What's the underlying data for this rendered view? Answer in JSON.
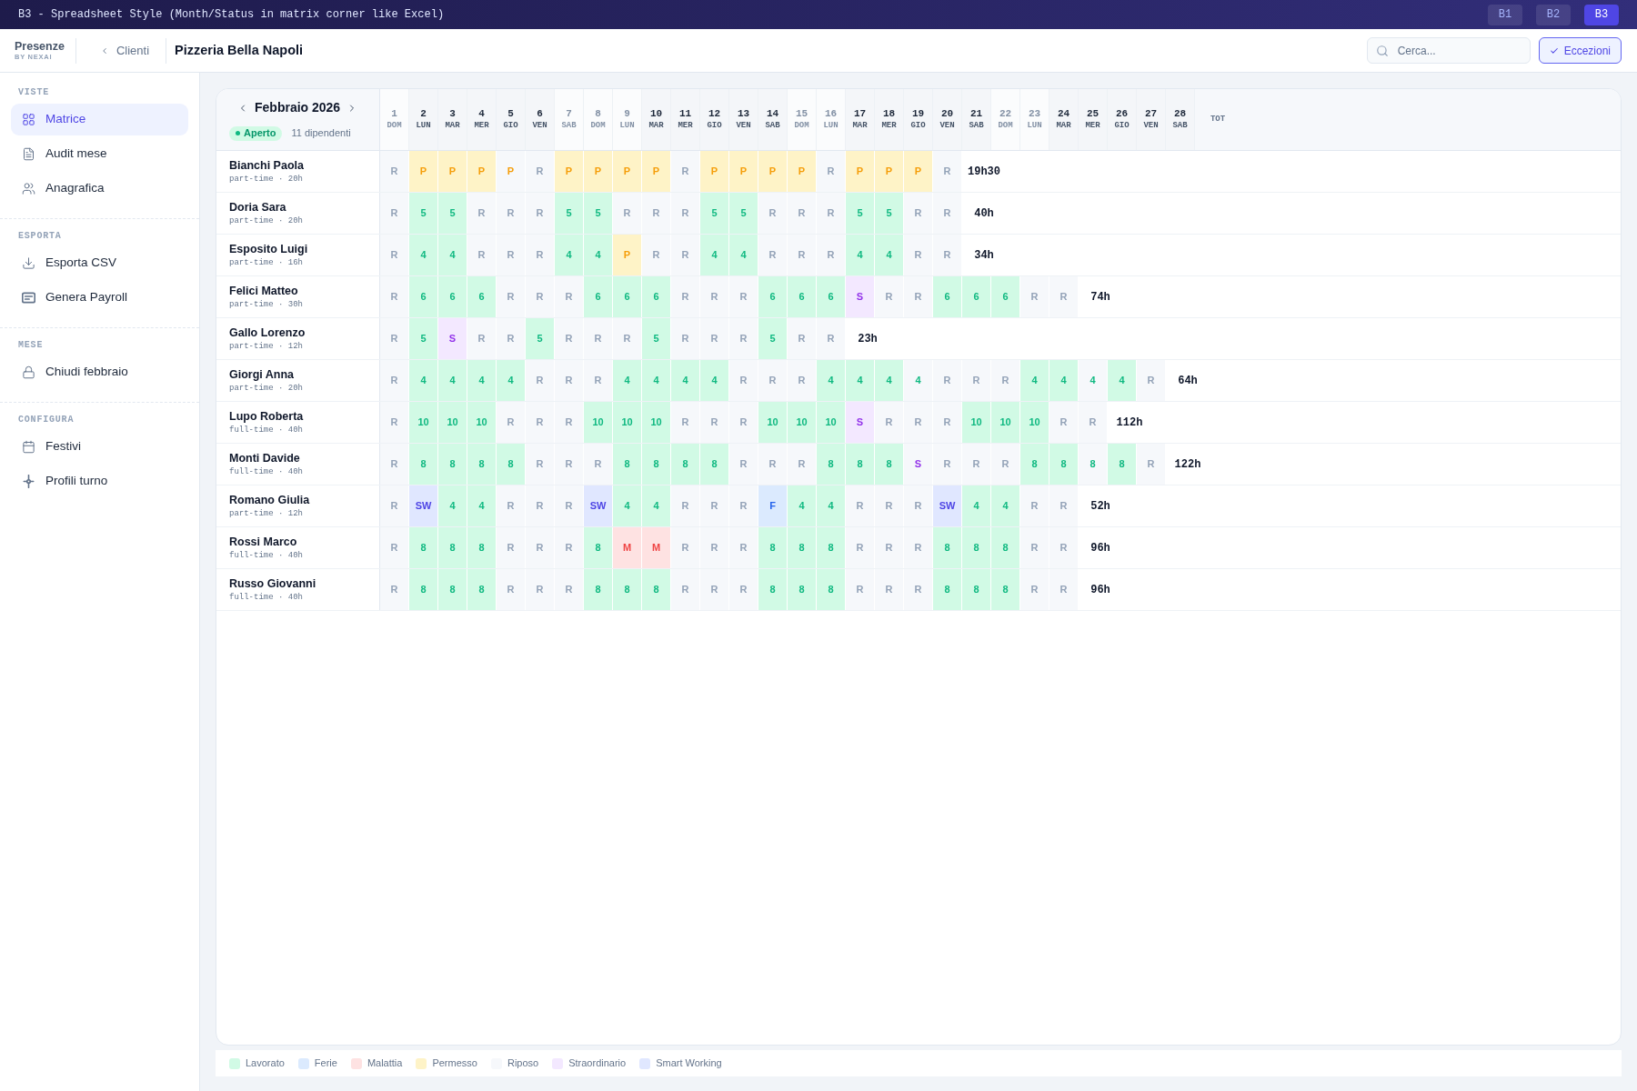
{
  "window": {
    "title": "B3 - Spreadsheet Style (Month/Status in matrix corner like Excel)",
    "variants": [
      {
        "label": "B1",
        "selected": false
      },
      {
        "label": "B2",
        "selected": false
      },
      {
        "label": "B3",
        "selected": true
      }
    ]
  },
  "header": {
    "brand": "Presenze",
    "brand_tagline": "BY NEXAI",
    "back_link": "Clienti",
    "client": "Pizzeria Bella Napoli",
    "search": {
      "placeholder": "Cerca..."
    },
    "exceptions_button": "Eccezioni"
  },
  "sidebar": {
    "sections": [
      {
        "label": "VISTE",
        "items": [
          {
            "label": "Matrice",
            "selected": true
          },
          {
            "label": "Audit mese",
            "selected": false
          },
          {
            "label": "Anagrafica",
            "selected": false
          }
        ]
      },
      {
        "label": "ESPORTA",
        "items": [
          {
            "label": "Esporta CSV",
            "selected": false
          },
          {
            "label": "Genera Payroll",
            "selected": false
          }
        ]
      },
      {
        "label": "MESE",
        "items": [
          {
            "label": "Chiudi febbraio",
            "selected": false
          }
        ]
      },
      {
        "label": "CONFIGURA",
        "items": [
          {
            "label": "Festivi",
            "selected": false
          },
          {
            "label": "Profili turno",
            "selected": false
          }
        ]
      }
    ]
  },
  "matrix": {
    "month": "Febbraio 2026",
    "status": "Aperto",
    "employee_count": "11 dipendenti",
    "days": [
      {
        "number": "1",
        "weekday": "DOM",
        "muted": true
      },
      {
        "number": "2",
        "weekday": "LUN",
        "muted": false
      },
      {
        "number": "3",
        "weekday": "MAR",
        "muted": false
      },
      {
        "number": "4",
        "weekday": "MER",
        "muted": false
      },
      {
        "number": "5",
        "weekday": "GIO",
        "muted": false
      },
      {
        "number": "6",
        "weekday": "VEN",
        "muted": false
      },
      {
        "number": "7",
        "weekday": "SAB",
        "muted": true
      },
      {
        "number": "8",
        "weekday": "DOM",
        "muted": true
      },
      {
        "number": "9",
        "weekday": "LUN",
        "muted": true
      },
      {
        "number": "10",
        "weekday": "MAR",
        "muted": false
      },
      {
        "number": "11",
        "weekday": "MER",
        "muted": false
      },
      {
        "number": "12",
        "weekday": "GIO",
        "muted": false
      },
      {
        "number": "13",
        "weekday": "VEN",
        "muted": false
      },
      {
        "number": "14",
        "weekday": "SAB",
        "muted": false
      },
      {
        "number": "15",
        "weekday": "DOM",
        "muted": true
      },
      {
        "number": "16",
        "weekday": "LUN",
        "muted": true
      },
      {
        "number": "17",
        "weekday": "MAR",
        "muted": false
      },
      {
        "number": "18",
        "weekday": "MER",
        "muted": false
      },
      {
        "number": "19",
        "weekday": "GIO",
        "muted": false
      },
      {
        "number": "20",
        "weekday": "VEN",
        "muted": false
      },
      {
        "number": "21",
        "weekday": "SAB",
        "muted": false
      },
      {
        "number": "22",
        "weekday": "DOM",
        "muted": true
      },
      {
        "number": "23",
        "weekday": "LUN",
        "muted": true
      },
      {
        "number": "24",
        "weekday": "MAR",
        "muted": false
      },
      {
        "number": "25",
        "weekday": "MER",
        "muted": false
      },
      {
        "number": "26",
        "weekday": "GIO",
        "muted": false
      },
      {
        "number": "27",
        "weekday": "VEN",
        "muted": false
      },
      {
        "number": "28",
        "weekday": "SAB",
        "muted": false
      }
    ],
    "total_header": "TOT",
    "rows": [
      {
        "name": "Bianchi Paola",
        "contract": "part-time · 20h",
        "total": "19h30",
        "cells": [
          {
            "text": "R",
            "kind": "riposo"
          },
          {
            "text": "P",
            "kind": "permesso",
            "filled": true
          },
          {
            "text": "P",
            "kind": "permesso",
            "filled": true
          },
          {
            "text": "P",
            "kind": "permesso",
            "filled": true
          },
          {
            "text": "P",
            "kind": "permesso",
            "filled": false
          },
          {
            "text": "R",
            "kind": "riposo"
          },
          {
            "text": "P",
            "kind": "permesso",
            "filled": true
          },
          {
            "text": "P",
            "kind": "permesso",
            "filled": true
          },
          {
            "text": "P",
            "kind": "permesso",
            "filled": true
          },
          {
            "text": "P",
            "kind": "permesso",
            "filled": true
          },
          {
            "text": "R",
            "kind": "riposo"
          },
          {
            "text": "P",
            "kind": "permesso",
            "filled": true
          },
          {
            "text": "P",
            "kind": "permesso",
            "filled": true
          },
          {
            "text": "P",
            "kind": "permesso",
            "filled": true
          },
          {
            "text": "P",
            "kind": "permesso",
            "filled": true
          },
          {
            "text": "R",
            "kind": "riposo"
          },
          {
            "text": "P",
            "kind": "permesso",
            "filled": true
          },
          {
            "text": "P",
            "kind": "permesso",
            "filled": true
          },
          {
            "text": "P",
            "kind": "permesso",
            "filled": true
          },
          {
            "text": "R",
            "kind": "riposo"
          }
        ]
      },
      {
        "name": "Doria Sara",
        "contract": "part-time · 20h",
        "total": "40h",
        "cells": [
          {
            "text": "R",
            "kind": "riposo"
          },
          {
            "text": "5",
            "kind": "lavorato",
            "filled": true
          },
          {
            "text": "5",
            "kind": "lavorato",
            "filled": true
          },
          {
            "text": "R",
            "kind": "riposo"
          },
          {
            "text": "R",
            "kind": "riposo"
          },
          {
            "text": "R",
            "kind": "riposo"
          },
          {
            "text": "5",
            "kind": "lavorato",
            "filled": true
          },
          {
            "text": "5",
            "kind": "lavorato",
            "filled": true
          },
          {
            "text": "R",
            "kind": "riposo"
          },
          {
            "text": "R",
            "kind": "riposo"
          },
          {
            "text": "R",
            "kind": "riposo"
          },
          {
            "text": "5",
            "kind": "lavorato",
            "filled": true
          },
          {
            "text": "5",
            "kind": "lavorato",
            "filled": true
          },
          {
            "text": "R",
            "kind": "riposo"
          },
          {
            "text": "R",
            "kind": "riposo"
          },
          {
            "text": "R",
            "kind": "riposo"
          },
          {
            "text": "5",
            "kind": "lavorato",
            "filled": true
          },
          {
            "text": "5",
            "kind": "lavorato",
            "filled": true
          },
          {
            "text": "R",
            "kind": "riposo"
          },
          {
            "text": "R",
            "kind": "riposo"
          }
        ]
      },
      {
        "name": "Esposito Luigi",
        "contract": "part-time · 16h",
        "total": "34h",
        "cells": [
          {
            "text": "R",
            "kind": "riposo"
          },
          {
            "text": "4",
            "kind": "lavorato",
            "filled": true
          },
          {
            "text": "4",
            "kind": "lavorato",
            "filled": true
          },
          {
            "text": "R",
            "kind": "riposo"
          },
          {
            "text": "R",
            "kind": "riposo"
          },
          {
            "text": "R",
            "kind": "riposo"
          },
          {
            "text": "4",
            "kind": "lavorato",
            "filled": true
          },
          {
            "text": "4",
            "kind": "lavorato",
            "filled": true
          },
          {
            "text": "P",
            "kind": "permesso",
            "filled": true
          },
          {
            "text": "R",
            "kind": "riposo"
          },
          {
            "text": "R",
            "kind": "riposo"
          },
          {
            "text": "4",
            "kind": "lavorato",
            "filled": true
          },
          {
            "text": "4",
            "kind": "lavorato",
            "filled": true
          },
          {
            "text": "R",
            "kind": "riposo"
          },
          {
            "text": "R",
            "kind": "riposo"
          },
          {
            "text": "R",
            "kind": "riposo"
          },
          {
            "text": "4",
            "kind": "lavorato",
            "filled": true
          },
          {
            "text": "4",
            "kind": "lavorato",
            "filled": true
          },
          {
            "text": "R",
            "kind": "riposo"
          },
          {
            "text": "R",
            "kind": "riposo"
          }
        ]
      },
      {
        "name": "Felici Matteo",
        "contract": "part-time · 30h",
        "total": "74h",
        "cells": [
          {
            "text": "R",
            "kind": "riposo"
          },
          {
            "text": "6",
            "kind": "lavorato",
            "filled": true
          },
          {
            "text": "6",
            "kind": "lavorato",
            "filled": true
          },
          {
            "text": "6",
            "kind": "lavorato",
            "filled": true
          },
          {
            "text": "R",
            "kind": "riposo"
          },
          {
            "text": "R",
            "kind": "riposo"
          },
          {
            "text": "R",
            "kind": "riposo"
          },
          {
            "text": "6",
            "kind": "lavorato",
            "filled": true
          },
          {
            "text": "6",
            "kind": "lavorato",
            "filled": true
          },
          {
            "text": "6",
            "kind": "lavorato",
            "filled": true
          },
          {
            "text": "R",
            "kind": "riposo"
          },
          {
            "text": "R",
            "kind": "riposo"
          },
          {
            "text": "R",
            "kind": "riposo"
          },
          {
            "text": "6",
            "kind": "lavorato",
            "filled": true
          },
          {
            "text": "6",
            "kind": "lavorato",
            "filled": true
          },
          {
            "text": "6",
            "kind": "lavorato",
            "filled": true
          },
          {
            "text": "S",
            "kind": "straordinario",
            "filled": true
          },
          {
            "text": "R",
            "kind": "riposo"
          },
          {
            "text": "R",
            "kind": "riposo"
          },
          {
            "text": "6",
            "kind": "lavorato",
            "filled": true
          },
          {
            "text": "6",
            "kind": "lavorato",
            "filled": true
          },
          {
            "text": "6",
            "kind": "lavorato",
            "filled": true
          },
          {
            "text": "R",
            "kind": "riposo"
          },
          {
            "text": "R",
            "kind": "riposo"
          }
        ]
      },
      {
        "name": "Gallo Lorenzo",
        "contract": "part-time · 12h",
        "total": "23h",
        "cells": [
          {
            "text": "R",
            "kind": "riposo"
          },
          {
            "text": "5",
            "kind": "lavorato",
            "filled": true
          },
          {
            "text": "S",
            "kind": "straordinario",
            "filled": true
          },
          {
            "text": "R",
            "kind": "riposo"
          },
          {
            "text": "R",
            "kind": "riposo"
          },
          {
            "text": "5",
            "kind": "lavorato",
            "filled": true
          },
          {
            "text": "R",
            "kind": "riposo"
          },
          {
            "text": "R",
            "kind": "riposo"
          },
          {
            "text": "R",
            "kind": "riposo"
          },
          {
            "text": "5",
            "kind": "lavorato",
            "filled": true
          },
          {
            "text": "R",
            "kind": "riposo"
          },
          {
            "text": "R",
            "kind": "riposo"
          },
          {
            "text": "R",
            "kind": "riposo"
          },
          {
            "text": "5",
            "kind": "lavorato",
            "filled": true
          },
          {
            "text": "R",
            "kind": "riposo"
          },
          {
            "text": "R",
            "kind": "riposo"
          }
        ]
      },
      {
        "name": "Giorgi Anna",
        "contract": "part-time · 20h",
        "total": "64h",
        "cells": [
          {
            "text": "R",
            "kind": "riposo"
          },
          {
            "text": "4",
            "kind": "lavorato",
            "filled": true
          },
          {
            "text": "4",
            "kind": "lavorato",
            "filled": true
          },
          {
            "text": "4",
            "kind": "lavorato",
            "filled": true
          },
          {
            "text": "4",
            "kind": "lavorato",
            "filled": true
          },
          {
            "text": "R",
            "kind": "riposo"
          },
          {
            "text": "R",
            "kind": "riposo"
          },
          {
            "text": "R",
            "kind": "riposo"
          },
          {
            "text": "4",
            "kind": "lavorato",
            "filled": true
          },
          {
            "text": "4",
            "kind": "lavorato",
            "filled": true
          },
          {
            "text": "4",
            "kind": "lavorato",
            "filled": true
          },
          {
            "text": "4",
            "kind": "lavorato",
            "filled": true
          },
          {
            "text": "R",
            "kind": "riposo"
          },
          {
            "text": "R",
            "kind": "riposo"
          },
          {
            "text": "R",
            "kind": "riposo"
          },
          {
            "text": "4",
            "kind": "lavorato",
            "filled": true
          },
          {
            "text": "4",
            "kind": "lavorato",
            "filled": true
          },
          {
            "text": "4",
            "kind": "lavorato",
            "filled": true
          },
          {
            "text": "4",
            "kind": "lavorato",
            "filled": false
          },
          {
            "text": "R",
            "kind": "riposo"
          },
          {
            "text": "R",
            "kind": "riposo"
          },
          {
            "text": "R",
            "kind": "riposo"
          },
          {
            "text": "4",
            "kind": "lavorato",
            "filled": true
          },
          {
            "text": "4",
            "kind": "lavorato",
            "filled": true
          },
          {
            "text": "4",
            "kind": "lavorato",
            "filled": false
          },
          {
            "text": "4",
            "kind": "lavorato",
            "filled": true
          },
          {
            "text": "R",
            "kind": "riposo"
          }
        ]
      },
      {
        "name": "Lupo Roberta",
        "contract": "full-time · 40h",
        "total": "112h",
        "cells": [
          {
            "text": "R",
            "kind": "riposo"
          },
          {
            "text": "10",
            "kind": "lavorato",
            "filled": true
          },
          {
            "text": "10",
            "kind": "lavorato",
            "filled": true
          },
          {
            "text": "10",
            "kind": "lavorato",
            "filled": true
          },
          {
            "text": "R",
            "kind": "riposo"
          },
          {
            "text": "R",
            "kind": "riposo"
          },
          {
            "text": "R",
            "kind": "riposo"
          },
          {
            "text": "10",
            "kind": "lavorato",
            "filled": true
          },
          {
            "text": "10",
            "kind": "lavorato",
            "filled": true
          },
          {
            "text": "10",
            "kind": "lavorato",
            "filled": true
          },
          {
            "text": "R",
            "kind": "riposo"
          },
          {
            "text": "R",
            "kind": "riposo"
          },
          {
            "text": "R",
            "kind": "riposo"
          },
          {
            "text": "10",
            "kind": "lavorato",
            "filled": true
          },
          {
            "text": "10",
            "kind": "lavorato",
            "filled": true
          },
          {
            "text": "10",
            "kind": "lavorato",
            "filled": true
          },
          {
            "text": "S",
            "kind": "straordinario",
            "filled": true
          },
          {
            "text": "R",
            "kind": "riposo"
          },
          {
            "text": "R",
            "kind": "riposo"
          },
          {
            "text": "R",
            "kind": "riposo"
          },
          {
            "text": "10",
            "kind": "lavorato",
            "filled": true
          },
          {
            "text": "10",
            "kind": "lavorato",
            "filled": true
          },
          {
            "text": "10",
            "kind": "lavorato",
            "filled": true
          },
          {
            "text": "R",
            "kind": "riposo"
          },
          {
            "text": "R",
            "kind": "riposo"
          }
        ]
      },
      {
        "name": "Monti Davide",
        "contract": "full-time · 40h",
        "total": "122h",
        "cells": [
          {
            "text": "R",
            "kind": "riposo"
          },
          {
            "text": "8",
            "kind": "lavorato",
            "filled": true
          },
          {
            "text": "8",
            "kind": "lavorato",
            "filled": true
          },
          {
            "text": "8",
            "kind": "lavorato",
            "filled": true
          },
          {
            "text": "8",
            "kind": "lavorato",
            "filled": true
          },
          {
            "text": "R",
            "kind": "riposo"
          },
          {
            "text": "R",
            "kind": "riposo"
          },
          {
            "text": "R",
            "kind": "riposo"
          },
          {
            "text": "8",
            "kind": "lavorato",
            "filled": true
          },
          {
            "text": "8",
            "kind": "lavorato",
            "filled": true
          },
          {
            "text": "8",
            "kind": "lavorato",
            "filled": true
          },
          {
            "text": "8",
            "kind": "lavorato",
            "filled": true
          },
          {
            "text": "R",
            "kind": "riposo"
          },
          {
            "text": "R",
            "kind": "riposo"
          },
          {
            "text": "R",
            "kind": "riposo"
          },
          {
            "text": "8",
            "kind": "lavorato",
            "filled": true
          },
          {
            "text": "8",
            "kind": "lavorato",
            "filled": true
          },
          {
            "text": "8",
            "kind": "lavorato",
            "filled": true
          },
          {
            "text": "S",
            "kind": "straordinario",
            "filled": false
          },
          {
            "text": "R",
            "kind": "riposo"
          },
          {
            "text": "R",
            "kind": "riposo"
          },
          {
            "text": "R",
            "kind": "riposo"
          },
          {
            "text": "8",
            "kind": "lavorato",
            "filled": true
          },
          {
            "text": "8",
            "kind": "lavorato",
            "filled": true
          },
          {
            "text": "8",
            "kind": "lavorato",
            "filled": false
          },
          {
            "text": "8",
            "kind": "lavorato",
            "filled": true
          },
          {
            "text": "R",
            "kind": "riposo"
          }
        ]
      },
      {
        "name": "Romano Giulia",
        "contract": "part-time · 12h",
        "total": "52h",
        "cells": [
          {
            "text": "R",
            "kind": "riposo"
          },
          {
            "text": "SW",
            "kind": "smart",
            "filled": true
          },
          {
            "text": "4",
            "kind": "lavorato",
            "filled": true
          },
          {
            "text": "4",
            "kind": "lavorato",
            "filled": true
          },
          {
            "text": "R",
            "kind": "riposo"
          },
          {
            "text": "R",
            "kind": "riposo"
          },
          {
            "text": "R",
            "kind": "riposo"
          },
          {
            "text": "SW",
            "kind": "smart",
            "filled": true
          },
          {
            "text": "4",
            "kind": "lavorato",
            "filled": true
          },
          {
            "text": "4",
            "kind": "lavorato",
            "filled": true
          },
          {
            "text": "R",
            "kind": "riposo"
          },
          {
            "text": "R",
            "kind": "riposo"
          },
          {
            "text": "R",
            "kind": "riposo"
          },
          {
            "text": "F",
            "kind": "ferie",
            "filled": true
          },
          {
            "text": "4",
            "kind": "lavorato",
            "filled": true
          },
          {
            "text": "4",
            "kind": "lavorato",
            "filled": true
          },
          {
            "text": "R",
            "kind": "riposo"
          },
          {
            "text": "R",
            "kind": "riposo"
          },
          {
            "text": "R",
            "kind": "riposo"
          },
          {
            "text": "SW",
            "kind": "smart",
            "filled": true
          },
          {
            "text": "4",
            "kind": "lavorato",
            "filled": true
          },
          {
            "text": "4",
            "kind": "lavorato",
            "filled": true
          },
          {
            "text": "R",
            "kind": "riposo"
          },
          {
            "text": "R",
            "kind": "riposo"
          }
        ]
      },
      {
        "name": "Rossi Marco",
        "contract": "full-time · 40h",
        "total": "96h",
        "cells": [
          {
            "text": "R",
            "kind": "riposo"
          },
          {
            "text": "8",
            "kind": "lavorato",
            "filled": true
          },
          {
            "text": "8",
            "kind": "lavorato",
            "filled": true
          },
          {
            "text": "8",
            "kind": "lavorato",
            "filled": true
          },
          {
            "text": "R",
            "kind": "riposo"
          },
          {
            "text": "R",
            "kind": "riposo"
          },
          {
            "text": "R",
            "kind": "riposo"
          },
          {
            "text": "8",
            "kind": "lavorato",
            "filled": true
          },
          {
            "text": "M",
            "kind": "malattia",
            "filled": true
          },
          {
            "text": "M",
            "kind": "malattia",
            "filled": true
          },
          {
            "text": "R",
            "kind": "riposo"
          },
          {
            "text": "R",
            "kind": "riposo"
          },
          {
            "text": "R",
            "kind": "riposo"
          },
          {
            "text": "8",
            "kind": "lavorato",
            "filled": true
          },
          {
            "text": "8",
            "kind": "lavorato",
            "filled": true
          },
          {
            "text": "8",
            "kind": "lavorato",
            "filled": true
          },
          {
            "text": "R",
            "kind": "riposo"
          },
          {
            "text": "R",
            "kind": "riposo"
          },
          {
            "text": "R",
            "kind": "riposo"
          },
          {
            "text": "8",
            "kind": "lavorato",
            "filled": true
          },
          {
            "text": "8",
            "kind": "lavorato",
            "filled": true
          },
          {
            "text": "8",
            "kind": "lavorato",
            "filled": true
          },
          {
            "text": "R",
            "kind": "riposo"
          },
          {
            "text": "R",
            "kind": "riposo"
          }
        ]
      },
      {
        "name": "Russo Giovanni",
        "contract": "full-time · 40h",
        "total": "96h",
        "cells": [
          {
            "text": "R",
            "kind": "riposo"
          },
          {
            "text": "8",
            "kind": "lavorato",
            "filled": true
          },
          {
            "text": "8",
            "kind": "lavorato",
            "filled": true
          },
          {
            "text": "8",
            "kind": "lavorato",
            "filled": true
          },
          {
            "text": "R",
            "kind": "riposo"
          },
          {
            "text": "R",
            "kind": "riposo"
          },
          {
            "text": "R",
            "kind": "riposo"
          },
          {
            "text": "8",
            "kind": "lavorato",
            "filled": true
          },
          {
            "text": "8",
            "kind": "lavorato",
            "filled": true
          },
          {
            "text": "8",
            "kind": "lavorato",
            "filled": true
          },
          {
            "text": "R",
            "kind": "riposo"
          },
          {
            "text": "R",
            "kind": "riposo"
          },
          {
            "text": "R",
            "kind": "riposo"
          },
          {
            "text": "8",
            "kind": "lavorato",
            "filled": true
          },
          {
            "text": "8",
            "kind": "lavorato",
            "filled": true
          },
          {
            "text": "8",
            "kind": "lavorato",
            "filled": true
          },
          {
            "text": "R",
            "kind": "riposo"
          },
          {
            "text": "R",
            "kind": "riposo"
          },
          {
            "text": "R",
            "kind": "riposo"
          },
          {
            "text": "8",
            "kind": "lavorato",
            "filled": true
          },
          {
            "text": "8",
            "kind": "lavorato",
            "filled": true
          },
          {
            "text": "8",
            "kind": "lavorato",
            "filled": true
          },
          {
            "text": "R",
            "kind": "riposo"
          },
          {
            "text": "R",
            "kind": "riposo"
          }
        ]
      }
    ]
  },
  "legend": [
    {
      "label": "Lavorato",
      "kind": "lavorato"
    },
    {
      "label": "Ferie",
      "kind": "ferie"
    },
    {
      "label": "Malattia",
      "kind": "malattia"
    },
    {
      "label": "Permesso",
      "kind": "permesso"
    },
    {
      "label": "Riposo",
      "kind": "riposo"
    },
    {
      "label": "Straordinario",
      "kind": "straordinario"
    },
    {
      "label": "Smart Working",
      "kind": "smart"
    }
  ]
}
